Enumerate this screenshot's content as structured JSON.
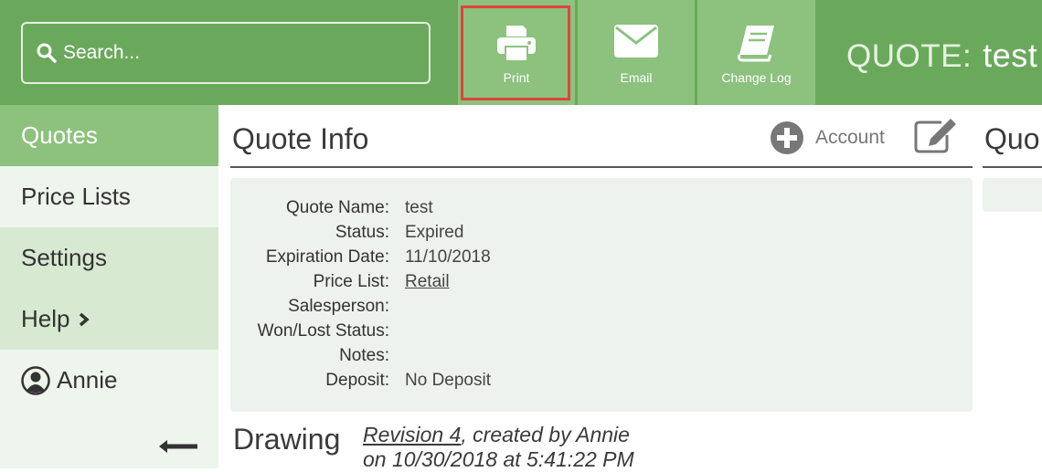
{
  "header": {
    "search": {
      "placeholder": "Search..."
    },
    "toolbar": {
      "print_label": "Print",
      "email_label": "Email",
      "changelog_label": "Change Log"
    },
    "title_prefix": "QUOTE:",
    "title_name": "test"
  },
  "sidebar": {
    "items": [
      {
        "label": "Quotes"
      },
      {
        "label": "Price Lists"
      },
      {
        "label": "Settings"
      },
      {
        "label": "Help"
      }
    ],
    "user_name": "Annie"
  },
  "quote_info": {
    "title": "Quote Info",
    "account_label": "Account",
    "fields": [
      {
        "label": "Quote Name:",
        "value": "test"
      },
      {
        "label": "Status:",
        "value": "Expired"
      },
      {
        "label": "Expiration Date:",
        "value": "11/10/2018"
      },
      {
        "label": "Price List:",
        "value": "Retail"
      },
      {
        "label": "Salesperson:",
        "value": ""
      },
      {
        "label": "Won/Lost Status:",
        "value": ""
      },
      {
        "label": "Notes:",
        "value": ""
      },
      {
        "label": "Deposit:",
        "value": "No Deposit"
      }
    ]
  },
  "drawing": {
    "title": "Drawing",
    "revision_link": "Revision 4",
    "created_by": ", created by Annie",
    "created_on": "on 10/30/2018 at 5:41:22 PM"
  },
  "right_section": {
    "title": "Quo"
  },
  "colors": {
    "header_green": "#6aa95c",
    "button_green": "#8cc17e",
    "highlight_red": "#e0443c"
  }
}
